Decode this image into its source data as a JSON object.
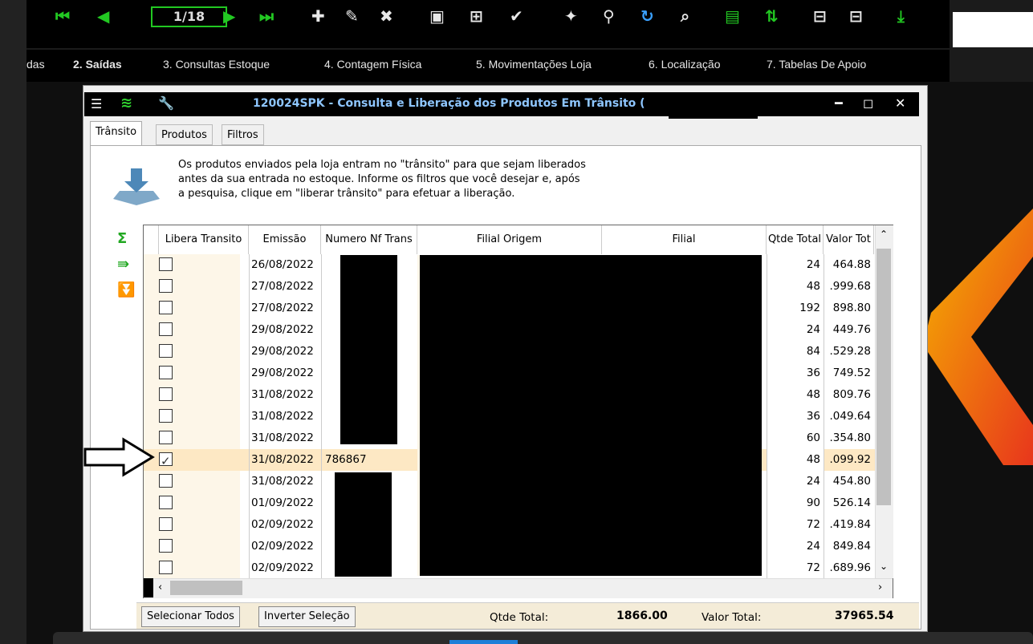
{
  "toolbar": {
    "pager": "1/18",
    "icons": [
      "first-icon",
      "prev-icon",
      "next-icon",
      "last-icon",
      "add-icon",
      "edit-icon",
      "delete-icon",
      "save-icon",
      "add-row-icon",
      "confirm-icon",
      "tools-icon",
      "search-icon",
      "refresh-icon",
      "zoom-icon",
      "print-icon",
      "sort-icon",
      "insert-icon",
      "remove-icon",
      "download-icon"
    ]
  },
  "menu": {
    "partial_left": "das",
    "items": [
      "2. Saídas",
      "3. Consultas Estoque",
      "4. Contagem Física",
      "5. Movimentações Loja",
      "6. Localização",
      "7. Tabelas De Apoio"
    ]
  },
  "dialog": {
    "title": "120024SPK - Consulta e Liberação dos Produtos Em Trânsito (",
    "tabs": [
      "Trânsito",
      "Produtos",
      "Filtros"
    ],
    "info_lines": [
      "Os produtos enviados pela loja entram no \"trânsito\" para que sejam liberados",
      "antes da sua entrada no estoque. Informe os filtros que você desejar e, após",
      "a pesquisa, clique em \"liberar trânsito\" para efetuar a liberação."
    ],
    "columns": {
      "libera": "Libera Transito",
      "emissao": "Emissão",
      "nf": "Numero Nf Trans",
      "origem": "Filial Origem",
      "filial": "Filial",
      "qtde": "Qtde Total",
      "valor": "Valor Tot"
    },
    "rows": [
      {
        "checked": false,
        "emissao": "26/08/2022",
        "nf": "",
        "qtde": "24",
        "valor": "464.88"
      },
      {
        "checked": false,
        "emissao": "27/08/2022",
        "nf": "",
        "qtde": "48",
        "valor": ".999.68"
      },
      {
        "checked": false,
        "emissao": "27/08/2022",
        "nf": "",
        "qtde": "192",
        "valor": "898.80"
      },
      {
        "checked": false,
        "emissao": "29/08/2022",
        "nf": "",
        "qtde": "24",
        "valor": "449.76"
      },
      {
        "checked": false,
        "emissao": "29/08/2022",
        "nf": "",
        "qtde": "84",
        "valor": ".529.28"
      },
      {
        "checked": false,
        "emissao": "29/08/2022",
        "nf": "",
        "qtde": "36",
        "valor": "749.52"
      },
      {
        "checked": false,
        "emissao": "31/08/2022",
        "nf": "",
        "qtde": "48",
        "valor": "809.76"
      },
      {
        "checked": false,
        "emissao": "31/08/2022",
        "nf": "",
        "qtde": "36",
        "valor": ".049.64"
      },
      {
        "checked": false,
        "emissao": "31/08/2022",
        "nf": "",
        "qtde": "60",
        "valor": ".354.80"
      },
      {
        "checked": true,
        "emissao": "31/08/2022",
        "nf": "786867",
        "qtde": "48",
        "valor": ".099.92"
      },
      {
        "checked": false,
        "emissao": "31/08/2022",
        "nf": "",
        "qtde": "24",
        "valor": "454.80"
      },
      {
        "checked": false,
        "emissao": "01/09/2022",
        "nf": "",
        "qtde": "90",
        "valor": "526.14"
      },
      {
        "checked": false,
        "emissao": "02/09/2022",
        "nf": "",
        "qtde": "72",
        "valor": ".419.84"
      },
      {
        "checked": false,
        "emissao": "02/09/2022",
        "nf": "",
        "qtde": "24",
        "valor": "849.84"
      },
      {
        "checked": false,
        "emissao": "02/09/2022",
        "nf": "",
        "qtde": "72",
        "valor": ".689.96"
      }
    ],
    "footer": {
      "select_all": "Selecionar Todos",
      "invert": "Inverter Seleção",
      "qtde_label": "Qtde Total:",
      "qtde_value": "1866.00",
      "valor_label": "Valor Total:",
      "valor_value": "37965.54"
    }
  }
}
